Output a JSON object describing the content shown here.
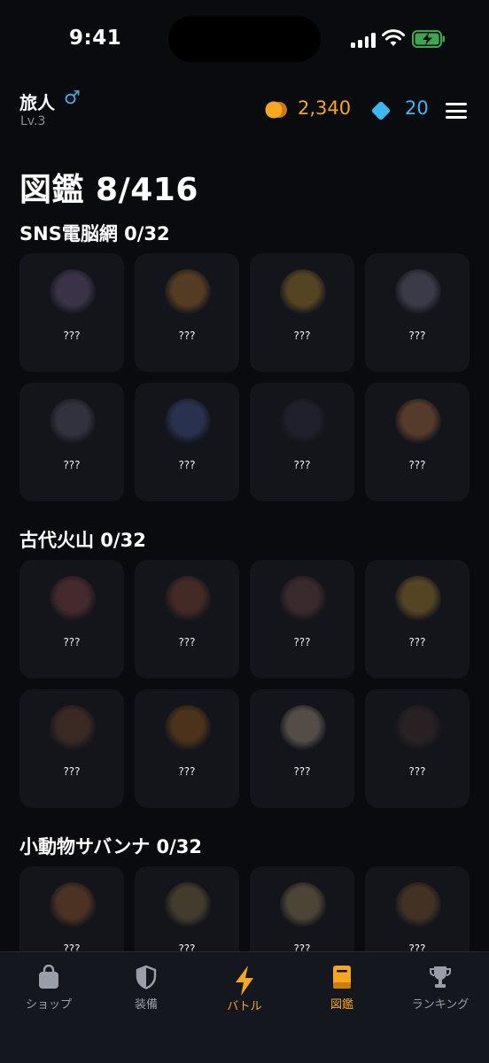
{
  "status_bar": {
    "time": "9:41"
  },
  "header": {
    "player_name": "旅人",
    "gender_symbol": "♂",
    "level": "Lv.3",
    "coins": "2,340",
    "gems": "20",
    "coin_color": "#f5a623",
    "gem_color": "#3bb8f0"
  },
  "page_title": "図鑑 8/416",
  "sections": [
    {
      "title": "SNS電脳網 0/32",
      "cards": [
        {
          "label": "???",
          "tint": "#5a4a6a"
        },
        {
          "label": "???",
          "tint": "#8a5a2a"
        },
        {
          "label": "???",
          "tint": "#8a6a2a"
        },
        {
          "label": "???",
          "tint": "#5a5a6a"
        },
        {
          "label": "???",
          "tint": "#4a4a5a"
        },
        {
          "label": "???",
          "tint": "#3a4a7a"
        },
        {
          "label": "???",
          "tint": "#2a2a3a"
        },
        {
          "label": "???",
          "tint": "#8a5a3a"
        }
      ]
    },
    {
      "title": "古代火山 0/32",
      "cards": [
        {
          "label": "???",
          "tint": "#6a3a3a"
        },
        {
          "label": "???",
          "tint": "#6a3a2a"
        },
        {
          "label": "???",
          "tint": "#5a3a3a"
        },
        {
          "label": "???",
          "tint": "#8a6a2a"
        },
        {
          "label": "???",
          "tint": "#5a3a2a"
        },
        {
          "label": "???",
          "tint": "#7a4a1a"
        },
        {
          "label": "???",
          "tint": "#8a7a6a"
        },
        {
          "label": "???",
          "tint": "#3a2a2a"
        }
      ]
    },
    {
      "title": "小動物サバンナ 0/32",
      "cards": [
        {
          "label": "???",
          "tint": "#7a4a2a"
        },
        {
          "label": "???",
          "tint": "#6a5a3a"
        },
        {
          "label": "???",
          "tint": "#7a6a4a"
        },
        {
          "label": "???",
          "tint": "#6a4a2a"
        }
      ]
    }
  ],
  "tabs": [
    {
      "label": "ショップ",
      "icon": "shopping-bag-icon",
      "active": false
    },
    {
      "label": "装備",
      "icon": "shield-icon",
      "active": false
    },
    {
      "label": "バトル",
      "icon": "lightning-icon",
      "active": true
    },
    {
      "label": "図鑑",
      "icon": "book-icon",
      "active": true
    },
    {
      "label": "ランキング",
      "icon": "trophy-icon",
      "active": false
    }
  ],
  "colors": {
    "accent": "#f5a623",
    "background": "#0a0b0f",
    "card": "#13151b"
  }
}
